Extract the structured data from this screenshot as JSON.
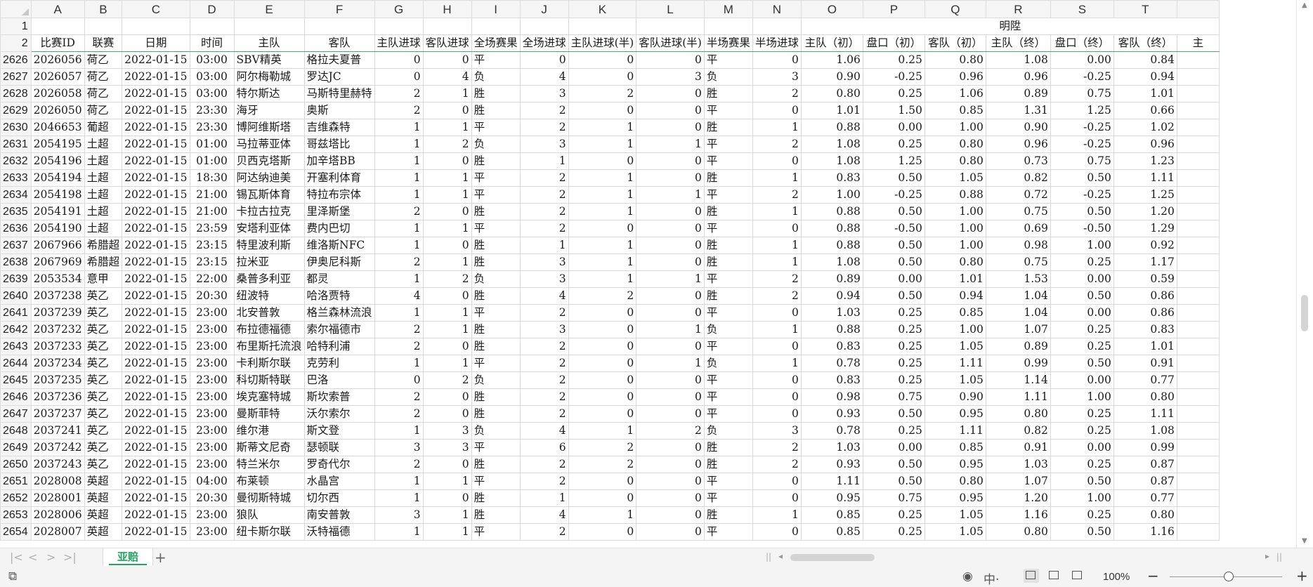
{
  "columns": [
    "A",
    "B",
    "C",
    "D",
    "E",
    "F",
    "G",
    "H",
    "I",
    "J",
    "K",
    "L",
    "M",
    "N",
    "O",
    "P",
    "Q",
    "R",
    "S",
    "T"
  ],
  "row1": {
    "num": "1",
    "group_label": "明陞"
  },
  "header_row": {
    "num": "2",
    "cells": [
      "比赛ID",
      "联赛",
      "日期",
      "时间",
      "主队",
      "客队",
      "主队进球",
      "客队进球",
      "全场赛果",
      "全场进球",
      "主队进球(半)",
      "客队进球(半)",
      "半场赛果",
      "半场进球",
      "主队（初）",
      "盘口（初）",
      "客队（初）",
      "主队（终）",
      "盘口（终）",
      "客队（终）",
      "主"
    ]
  },
  "rows": [
    {
      "n": "2626",
      "c": [
        "2026056",
        "荷乙",
        "2022-01-15",
        "03:00",
        "SBV精英",
        "格拉夫夏普",
        "0",
        "0",
        "平",
        "0",
        "0",
        "0",
        "平",
        "0",
        "1.06",
        "0.25",
        "0.80",
        "1.08",
        "0.00",
        "0.84"
      ]
    },
    {
      "n": "2627",
      "c": [
        "2026057",
        "荷乙",
        "2022-01-15",
        "03:00",
        "阿尔梅勒城",
        "罗达JC",
        "0",
        "4",
        "负",
        "4",
        "0",
        "3",
        "负",
        "3",
        "0.90",
        "-0.25",
        "0.96",
        "0.96",
        "-0.25",
        "0.94"
      ]
    },
    {
      "n": "2628",
      "c": [
        "2026058",
        "荷乙",
        "2022-01-15",
        "03:00",
        "特尔斯达",
        "马斯特里赫特",
        "2",
        "1",
        "胜",
        "3",
        "2",
        "0",
        "胜",
        "2",
        "0.80",
        "0.25",
        "1.06",
        "0.89",
        "0.75",
        "1.01"
      ]
    },
    {
      "n": "2629",
      "c": [
        "2026050",
        "荷乙",
        "2022-01-15",
        "23:30",
        "海牙",
        "奥斯",
        "2",
        "0",
        "胜",
        "2",
        "0",
        "0",
        "平",
        "0",
        "1.01",
        "1.50",
        "0.85",
        "1.31",
        "1.25",
        "0.66"
      ]
    },
    {
      "n": "2630",
      "c": [
        "2046653",
        "葡超",
        "2022-01-15",
        "23:30",
        "博阿维斯塔",
        "吉维森特",
        "1",
        "1",
        "平",
        "2",
        "1",
        "0",
        "胜",
        "1",
        "0.88",
        "0.00",
        "1.00",
        "0.90",
        "-0.25",
        "1.02"
      ]
    },
    {
      "n": "2631",
      "c": [
        "2054195",
        "土超",
        "2022-01-15",
        "01:00",
        "马拉蒂亚体",
        "哥兹塔比",
        "1",
        "2",
        "负",
        "3",
        "1",
        "1",
        "平",
        "2",
        "1.08",
        "0.25",
        "0.80",
        "0.96",
        "-0.25",
        "0.96"
      ]
    },
    {
      "n": "2632",
      "c": [
        "2054196",
        "土超",
        "2022-01-15",
        "01:00",
        "贝西克塔斯",
        "加辛塔BB",
        "1",
        "0",
        "胜",
        "1",
        "0",
        "0",
        "平",
        "0",
        "1.08",
        "1.25",
        "0.80",
        "0.73",
        "0.75",
        "1.23"
      ]
    },
    {
      "n": "2633",
      "c": [
        "2054194",
        "土超",
        "2022-01-15",
        "18:30",
        "阿达纳迪美",
        "开塞利体育",
        "1",
        "1",
        "平",
        "2",
        "1",
        "0",
        "胜",
        "1",
        "0.83",
        "0.50",
        "1.05",
        "0.82",
        "0.50",
        "1.11"
      ]
    },
    {
      "n": "2634",
      "c": [
        "2054198",
        "土超",
        "2022-01-15",
        "21:00",
        "锡瓦斯体育",
        "特拉布宗体",
        "1",
        "1",
        "平",
        "2",
        "1",
        "1",
        "平",
        "2",
        "1.00",
        "-0.25",
        "0.88",
        "0.72",
        "-0.25",
        "1.25"
      ]
    },
    {
      "n": "2635",
      "c": [
        "2054191",
        "土超",
        "2022-01-15",
        "21:00",
        "卡拉古拉克",
        "里泽斯堡",
        "2",
        "0",
        "胜",
        "2",
        "1",
        "0",
        "胜",
        "1",
        "0.88",
        "0.50",
        "1.00",
        "0.75",
        "0.50",
        "1.20"
      ]
    },
    {
      "n": "2636",
      "c": [
        "2054190",
        "土超",
        "2022-01-15",
        "23:59",
        "安塔利亚体",
        "费内巴切",
        "1",
        "1",
        "平",
        "2",
        "0",
        "0",
        "平",
        "0",
        "0.88",
        "-0.50",
        "1.00",
        "0.69",
        "-0.50",
        "1.29"
      ]
    },
    {
      "n": "2637",
      "c": [
        "2067966",
        "希腊超",
        "2022-01-15",
        "23:15",
        "特里波利斯",
        "维洛斯NFC",
        "1",
        "0",
        "胜",
        "1",
        "1",
        "0",
        "胜",
        "1",
        "0.88",
        "0.50",
        "1.00",
        "0.98",
        "1.00",
        "0.92"
      ]
    },
    {
      "n": "2638",
      "c": [
        "2067969",
        "希腊超",
        "2022-01-15",
        "23:15",
        "拉米亚",
        "伊奥尼科斯",
        "2",
        "1",
        "胜",
        "3",
        "1",
        "0",
        "胜",
        "1",
        "1.08",
        "0.50",
        "0.80",
        "0.75",
        "0.25",
        "1.17"
      ]
    },
    {
      "n": "2639",
      "c": [
        "2053534",
        "意甲",
        "2022-01-15",
        "22:00",
        "桑普多利亚",
        "都灵",
        "1",
        "2",
        "负",
        "3",
        "1",
        "1",
        "平",
        "2",
        "0.89",
        "0.00",
        "1.01",
        "1.53",
        "0.00",
        "0.59"
      ]
    },
    {
      "n": "2640",
      "c": [
        "2037238",
        "英乙",
        "2022-01-15",
        "20:30",
        "纽波特",
        "哈洛贾特",
        "4",
        "0",
        "胜",
        "4",
        "2",
        "0",
        "胜",
        "2",
        "0.94",
        "0.50",
        "0.94",
        "1.04",
        "0.50",
        "0.86"
      ]
    },
    {
      "n": "2641",
      "c": [
        "2037239",
        "英乙",
        "2022-01-15",
        "23:00",
        "北安普敦",
        "格兰森林流浪",
        "1",
        "1",
        "平",
        "2",
        "0",
        "0",
        "平",
        "0",
        "1.03",
        "0.25",
        "0.85",
        "1.04",
        "0.00",
        "0.86"
      ]
    },
    {
      "n": "2642",
      "c": [
        "2037232",
        "英乙",
        "2022-01-15",
        "23:00",
        "布拉德福德",
        "索尔福德市",
        "2",
        "1",
        "胜",
        "3",
        "0",
        "1",
        "负",
        "1",
        "0.88",
        "0.25",
        "1.00",
        "1.07",
        "0.25",
        "0.83"
      ]
    },
    {
      "n": "2643",
      "c": [
        "2037233",
        "英乙",
        "2022-01-15",
        "23:00",
        "布里斯托流浪",
        "哈特利浦",
        "2",
        "0",
        "胜",
        "2",
        "0",
        "0",
        "平",
        "0",
        "0.83",
        "0.25",
        "1.05",
        "0.89",
        "0.25",
        "1.01"
      ]
    },
    {
      "n": "2644",
      "c": [
        "2037234",
        "英乙",
        "2022-01-15",
        "23:00",
        "卡利斯尔联",
        "克劳利",
        "1",
        "1",
        "平",
        "2",
        "0",
        "1",
        "负",
        "1",
        "0.78",
        "0.25",
        "1.11",
        "0.99",
        "0.50",
        "0.91"
      ]
    },
    {
      "n": "2645",
      "c": [
        "2037235",
        "英乙",
        "2022-01-15",
        "23:00",
        "科切斯特联",
        "巴洛",
        "0",
        "2",
        "负",
        "2",
        "0",
        "0",
        "平",
        "0",
        "0.83",
        "0.25",
        "1.05",
        "1.14",
        "0.00",
        "0.77"
      ]
    },
    {
      "n": "2646",
      "c": [
        "2037236",
        "英乙",
        "2022-01-15",
        "23:00",
        "埃克塞特城",
        "斯坎索普",
        "2",
        "0",
        "胜",
        "2",
        "0",
        "0",
        "平",
        "0",
        "0.98",
        "0.75",
        "0.90",
        "1.11",
        "1.00",
        "0.80"
      ]
    },
    {
      "n": "2647",
      "c": [
        "2037237",
        "英乙",
        "2022-01-15",
        "23:00",
        "曼斯菲特",
        "沃尔索尔",
        "2",
        "0",
        "胜",
        "2",
        "0",
        "0",
        "平",
        "0",
        "0.93",
        "0.50",
        "0.95",
        "0.80",
        "0.25",
        "1.11"
      ]
    },
    {
      "n": "2648",
      "c": [
        "2037241",
        "英乙",
        "2022-01-15",
        "23:00",
        "维尔港",
        "斯文登",
        "1",
        "3",
        "负",
        "4",
        "1",
        "2",
        "负",
        "3",
        "0.78",
        "0.25",
        "1.11",
        "0.82",
        "0.25",
        "1.08"
      ]
    },
    {
      "n": "2649",
      "c": [
        "2037242",
        "英乙",
        "2022-01-15",
        "23:00",
        "斯蒂文尼奇",
        "瑟顿联",
        "3",
        "3",
        "平",
        "6",
        "2",
        "0",
        "胜",
        "2",
        "1.03",
        "0.00",
        "0.85",
        "0.91",
        "0.00",
        "0.99"
      ]
    },
    {
      "n": "2650",
      "c": [
        "2037243",
        "英乙",
        "2022-01-15",
        "23:00",
        "特兰米尔",
        "罗奇代尔",
        "2",
        "0",
        "胜",
        "2",
        "2",
        "0",
        "胜",
        "2",
        "0.93",
        "0.50",
        "0.95",
        "1.03",
        "0.25",
        "0.87"
      ]
    },
    {
      "n": "2651",
      "c": [
        "2028008",
        "英超",
        "2022-01-15",
        "04:00",
        "布莱顿",
        "水晶宫",
        "1",
        "1",
        "平",
        "2",
        "0",
        "0",
        "平",
        "0",
        "1.11",
        "0.50",
        "0.80",
        "1.07",
        "0.50",
        "0.87"
      ]
    },
    {
      "n": "2652",
      "c": [
        "2028001",
        "英超",
        "2022-01-15",
        "20:30",
        "曼彻斯特城",
        "切尔西",
        "1",
        "0",
        "胜",
        "1",
        "0",
        "0",
        "平",
        "0",
        "0.95",
        "0.75",
        "0.95",
        "1.20",
        "1.00",
        "0.77"
      ]
    },
    {
      "n": "2653",
      "c": [
        "2028006",
        "英超",
        "2022-01-15",
        "23:00",
        "狼队",
        "南安普敦",
        "3",
        "1",
        "胜",
        "4",
        "1",
        "0",
        "胜",
        "1",
        "0.85",
        "0.25",
        "1.05",
        "1.16",
        "0.25",
        "0.80"
      ]
    },
    {
      "n": "2654",
      "c": [
        "2028007",
        "英超",
        "2022-01-15",
        "23:00",
        "纽卡斯尔联",
        "沃特福德",
        "1",
        "1",
        "平",
        "2",
        "0",
        "0",
        "平",
        "0",
        "0.85",
        "0.25",
        "1.05",
        "0.80",
        "0.50",
        "1.16"
      ]
    }
  ],
  "sheet_tab": "亚赔",
  "zoom": "100%",
  "status_icons": [
    "eye-icon",
    "中·"
  ]
}
